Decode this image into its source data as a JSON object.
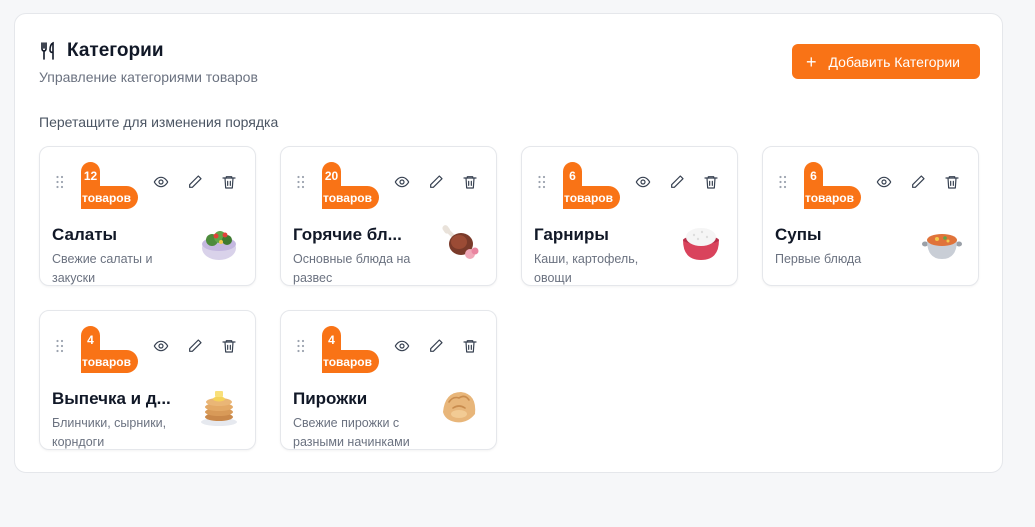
{
  "header": {
    "title": "Категории",
    "subtitle": "Управление категориями товаров",
    "add_button_label": "Добавить Категории"
  },
  "hint": "Перетащите для изменения порядка",
  "accent_color": "#f97316",
  "categories": [
    {
      "count": "12",
      "unit": "товаров",
      "name": "Салаты",
      "name_display": "Салаты",
      "description": "Свежие салаты и закуски",
      "icon": "salad-bowl-icon"
    },
    {
      "count": "20",
      "unit": "товаров",
      "name": "Горячие бл...",
      "name_display": "Горячие бл...",
      "description": "Основные блюда на развес",
      "icon": "meat-drumstick-icon"
    },
    {
      "count": "6",
      "unit": "товаров",
      "name": "Гарниры",
      "name_display": "Гарниры",
      "description": "Каши, картофель, овощи",
      "icon": "rice-bowl-icon"
    },
    {
      "count": "6",
      "unit": "товаров",
      "name": "Супы",
      "name_display": "Супы",
      "description": "Первые блюда",
      "icon": "soup-pot-icon"
    },
    {
      "count": "4",
      "unit": "товаров",
      "name": "Выпечка и д...",
      "name_display": "Выпечка и д...",
      "description": "Блинчики, сырники, корндоги",
      "icon": "pancakes-icon"
    },
    {
      "count": "4",
      "unit": "товаров",
      "name": "Пирожки",
      "name_display": "Пирожки",
      "description": "Свежие пирожки с разными начинками",
      "icon": "dumpling-icon"
    }
  ]
}
